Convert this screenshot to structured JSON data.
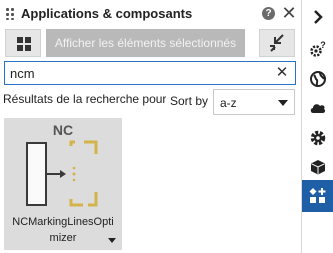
{
  "panel": {
    "title": "Applications & composants",
    "help_glyph": "?",
    "close_glyph": "✕"
  },
  "toolbar": {
    "show_selected_label": "Afficher les éléments sélectionnés"
  },
  "search": {
    "value": "ncm",
    "clear_glyph": "✕"
  },
  "results": {
    "label": "Résultats de la recherche pour 'ncm'"
  },
  "sort": {
    "label": "Sort by",
    "selected": "a-z"
  },
  "cards": [
    {
      "badge": "NC",
      "name": "NCMarkingLinesOptimizer"
    }
  ],
  "rail": {
    "items": [
      {
        "icon": "chevron-right-icon"
      },
      {
        "icon": "settings-help-icon"
      },
      {
        "icon": "globe-icon"
      },
      {
        "icon": "cloud-icon"
      },
      {
        "icon": "gear-icon"
      },
      {
        "icon": "cube-icon"
      },
      {
        "icon": "add-components-icon",
        "active": true
      }
    ]
  },
  "colors": {
    "accent": "#1f5fa8",
    "search_border": "#2a72c8",
    "card_bg": "#dcdcdc",
    "disabled_button": "#b9b9b9",
    "component_yellow": "#d4b44a"
  }
}
